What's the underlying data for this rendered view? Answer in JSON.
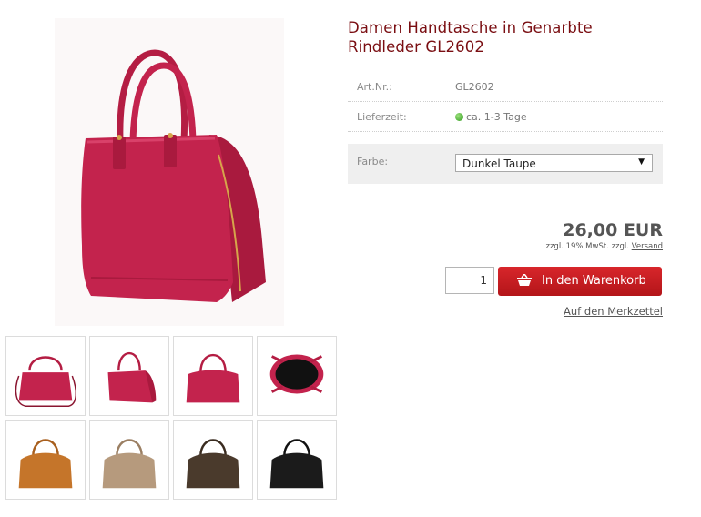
{
  "product": {
    "title_line1": "Damen Handtasche in Genarbte",
    "title_line2": "Rindleder GL2602",
    "main_image_color": "#c3234d"
  },
  "info": {
    "artnr_label": "Art.Nr.:",
    "artnr_value": "GL2602",
    "delivery_label": "Lieferzeit:",
    "delivery_value": "ca. 1-3 Tage",
    "delivery_status_color": "#2f9a1e"
  },
  "options": {
    "color_label": "Farbe:",
    "color_selected": "Dunkel Taupe"
  },
  "pricing": {
    "price": "26,00 EUR",
    "tax_text": "zzgl. 19% MwSt. zzgl. ",
    "shipping_link": "Versand"
  },
  "cart": {
    "quantity": "1",
    "add_button": "In den Warenkorb",
    "wishlist_link": "Auf den Merkzettel",
    "button_color": "#c81d22"
  },
  "thumbnails": [
    {
      "name": "pink-strap",
      "color": "#c3234d"
    },
    {
      "name": "pink-side",
      "color": "#c3234d"
    },
    {
      "name": "pink-front",
      "color": "#c3234d"
    },
    {
      "name": "pink-open",
      "color": "#c3234d"
    },
    {
      "name": "cognac",
      "color": "#c5752a"
    },
    {
      "name": "taupe",
      "color": "#b69a7d"
    },
    {
      "name": "dark-brown",
      "color": "#4a3a2c"
    },
    {
      "name": "black",
      "color": "#1b1b1b"
    }
  ]
}
